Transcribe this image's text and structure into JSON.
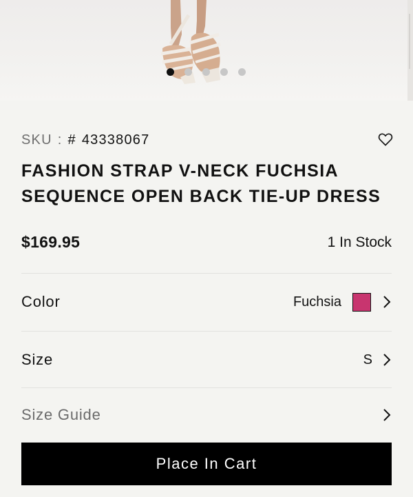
{
  "gallery": {
    "slide_count": 5,
    "active_slide": 1
  },
  "product": {
    "sku_label": "SKU",
    "sku_separator": ":",
    "sku_hash": "#",
    "sku_value": "43338067",
    "title_line1": "FASHION STRAP V-NECK FUCHSIA",
    "title_line2": "SEQUENCE OPEN BACK TIE-UP DRESS",
    "price": "$169.95",
    "stock": "1 In Stock"
  },
  "options": {
    "color_label": "Color",
    "color_value": "Fuchsia",
    "color_swatch": "#c8356f",
    "size_label": "Size",
    "size_value": "S",
    "size_guide_label": "Size Guide"
  },
  "actions": {
    "cart_label": "Place In Cart"
  },
  "icons": {
    "wishlist": "heart-outline-icon",
    "chevron": "chevron-right-icon"
  }
}
